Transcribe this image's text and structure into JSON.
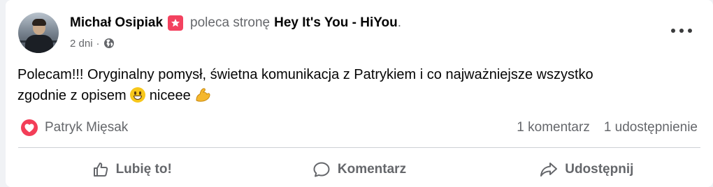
{
  "post": {
    "author": "Michał Osipiak",
    "recommends_text": "poleca stronę",
    "page_name": "Hey It's You - HiYou",
    "page_name_suffix": ".",
    "time": "2 dni",
    "separator": "·",
    "text_line1": "Polecam!!! Oryginalny pomysł, świetna komunikacja z Patrykiem i co najważniejsze wszystko",
    "text_line2_a": "zgodnie z opisem",
    "text_line2_b": "niceee",
    "icons": {
      "recommend": "recommend-star-icon",
      "privacy": "globe-icon",
      "more": "more-options-icon",
      "grin": "grinning-face-emoji",
      "arm": "flexed-biceps-emoji"
    }
  },
  "reactions": {
    "reactor": "Patryk Mięsak",
    "comments": "1 komentarz",
    "shares": "1 udostępnienie"
  },
  "actions": {
    "like": "Lubię to!",
    "comment": "Komentarz",
    "share": "Udostępnij"
  },
  "colors": {
    "recommend_badge": "#f3425f",
    "heart": "#f33e58",
    "muted_text": "#65676b"
  }
}
